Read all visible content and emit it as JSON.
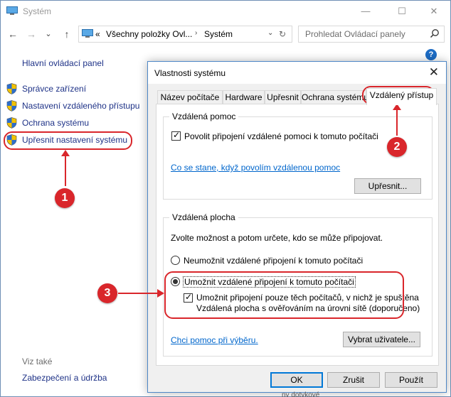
{
  "window": {
    "title": "Systém",
    "minimize": "—",
    "maximize": "☐",
    "close": "✕"
  },
  "nav": {
    "back": "←",
    "forward": "→",
    "recent": "⌄",
    "up": "↑",
    "breadcrumb_prefix": "«",
    "breadcrumb_1": "Všechny položky Ovl...",
    "breadcrumb_2": "Systém",
    "refresh": "↻",
    "search_placeholder": "Prohledat Ovládací panely"
  },
  "help": "?",
  "left_panel": {
    "home": "Hlavní ovládací panel",
    "tasks": [
      {
        "label": "Správce zařízení"
      },
      {
        "label": "Nastavení vzdáleného přístupu"
      },
      {
        "label": "Ochrana systému"
      },
      {
        "label": "Upřesnit nastavení systému"
      }
    ],
    "see_also": "Viz také",
    "security": "Zabezpečení a údržba"
  },
  "annotations": {
    "badge_1": "1",
    "badge_2": "2",
    "badge_3": "3",
    "color": "#d9262b"
  },
  "dialog": {
    "title": "Vlastnosti systému",
    "close": "✕",
    "tabs": [
      {
        "label": "Název počítače"
      },
      {
        "label": "Hardware"
      },
      {
        "label": "Upřesnit"
      },
      {
        "label": "Ochrana systému"
      },
      {
        "label": "Vzdálený přístup"
      }
    ],
    "active_tab": "Vzdálený přístup",
    "remote_assistance": {
      "group_title": "Vzdálená pomoc",
      "allow_checkbox": "Povolit připojení vzdálené pomoci k tomuto počítači",
      "allow_checked": true,
      "help_link": "Co se stane, když povolím vzdálenou pomoc",
      "advanced_button": "Upřesnit..."
    },
    "remote_desktop": {
      "group_title": "Vzdálená plocha",
      "instructions": "Zvolte možnost a potom určete, kdo se může připojovat.",
      "option_deny": "Neumožnit vzdálené připojení k tomuto počítači",
      "option_allow": "Umožnit vzdálené připojení k tomuto počítači",
      "selected": "allow",
      "nla_line1": "Umožnit připojení pouze těch počítačů, v nichž je spuštěna",
      "nla_line2": "Vzdálená plocha s ověřováním na úrovni sítě (doporučeno)",
      "nla_checked": true,
      "choice_help_link": "Chci pomoc při výběru.",
      "select_users_button": "Vybrat uživatele..."
    },
    "buttons": {
      "ok": "OK",
      "cancel": "Zrušit",
      "apply": "Použít"
    }
  },
  "partial_bottom_text": "ny dotykové"
}
